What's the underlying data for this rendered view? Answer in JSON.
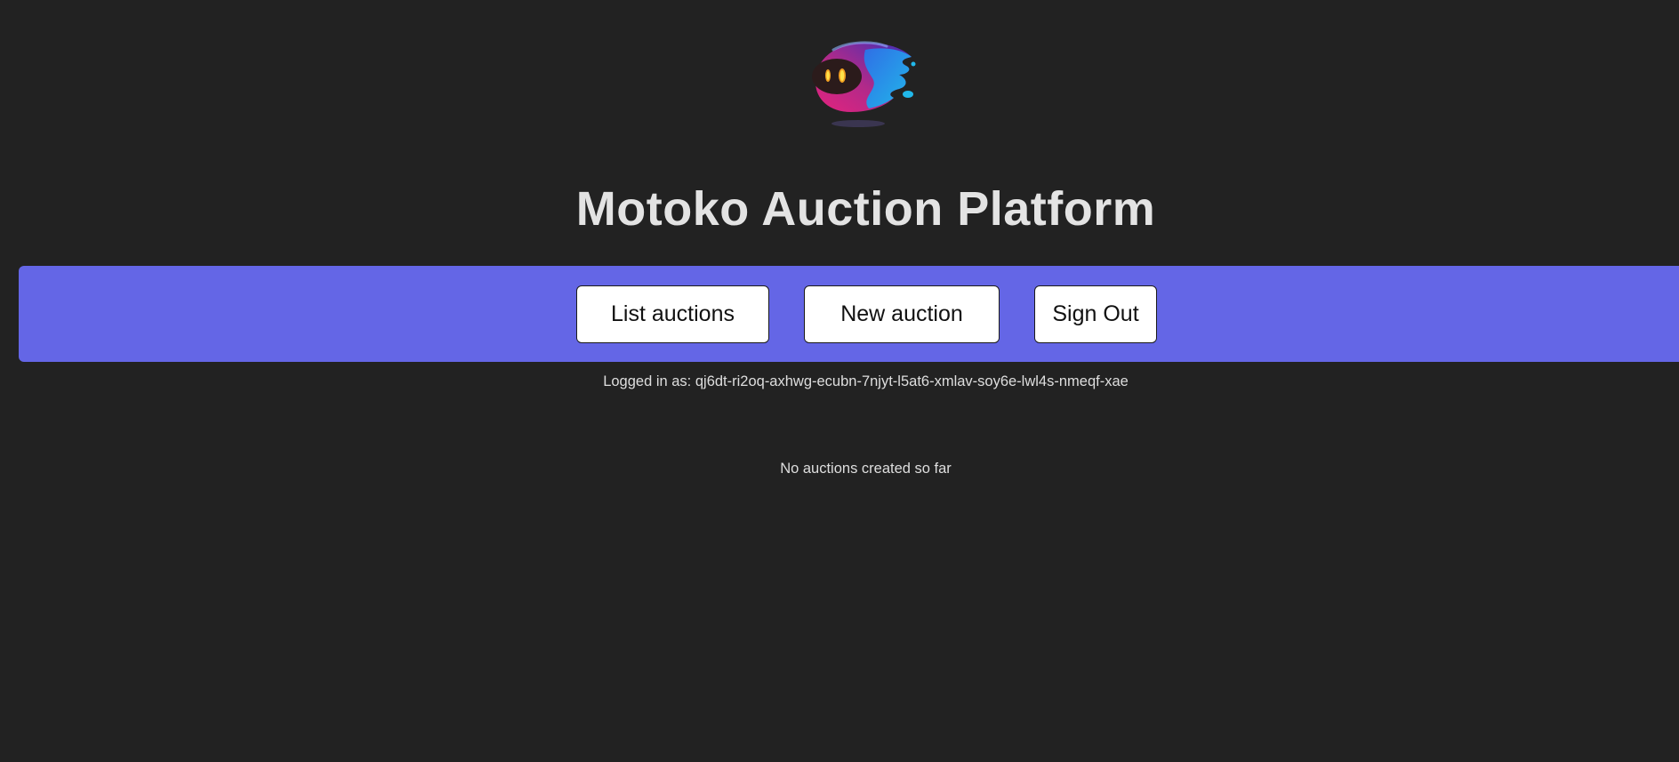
{
  "app": {
    "logo_icon": "motoko-ghost-logo-icon",
    "title": "Motoko Auction Platform"
  },
  "nav": {
    "background_color": "#6466e6",
    "buttons": [
      {
        "label": "List auctions"
      },
      {
        "label": "New auction"
      },
      {
        "label": "Sign Out"
      }
    ]
  },
  "session": {
    "logged_in_text": "Logged in as: qj6dt-ri2oq-axhwg-ecubn-7njyt-l5at6-xmlav-soy6e-lwl4s-nmeqf-xae"
  },
  "main": {
    "empty_message": "No auctions created so far"
  },
  "colors": {
    "page_background": "#222222",
    "accent": "#6466e6",
    "text": "#e3e3e3"
  }
}
